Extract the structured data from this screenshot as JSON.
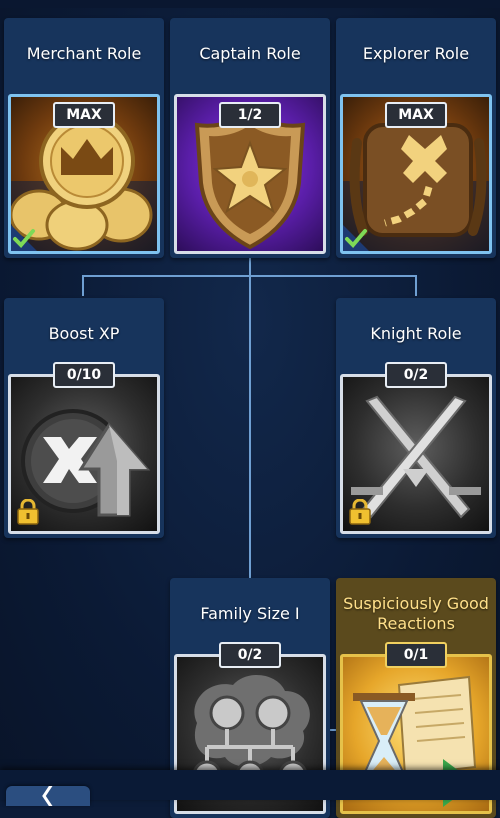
{
  "cards": {
    "merchant": {
      "title": "Merchant Role",
      "progress": "MAX",
      "completed": true,
      "locked": false
    },
    "captain": {
      "title": "Captain Role",
      "progress": "1/2",
      "completed": false,
      "locked": false
    },
    "explorer": {
      "title": "Explorer Role",
      "progress": "MAX",
      "completed": true,
      "locked": false
    },
    "boost_xp": {
      "title": "Boost XP",
      "progress": "0/10",
      "completed": false,
      "locked": true
    },
    "knight": {
      "title": "Knight Role",
      "progress": "0/2",
      "completed": false,
      "locked": true
    },
    "family_size": {
      "title": "Family Size I",
      "progress": "0/2",
      "completed": false,
      "locked": false
    },
    "suspicious": {
      "title": "Suspiciously Good Reactions",
      "progress": "0/1",
      "completed": false,
      "locked": false
    }
  },
  "icons": {
    "merchant": "coins-crown-icon",
    "captain": "sheriff-badge-icon",
    "explorer": "treasure-map-icon",
    "boost_xp": "xp-up-arrow-icon",
    "knight": "crossed-swords-icon",
    "family_size": "family-tree-icon",
    "suspicious": "hourglass-scroll-icon"
  },
  "colors": {
    "background": "#0c1c38",
    "card": "#17345c",
    "connector": "#6f9fd2",
    "check": "#7ed957",
    "gold_title": "#ffe08a",
    "purple": "#6a22c9"
  },
  "nav": {
    "back_icon": "back-arrow-icon"
  }
}
